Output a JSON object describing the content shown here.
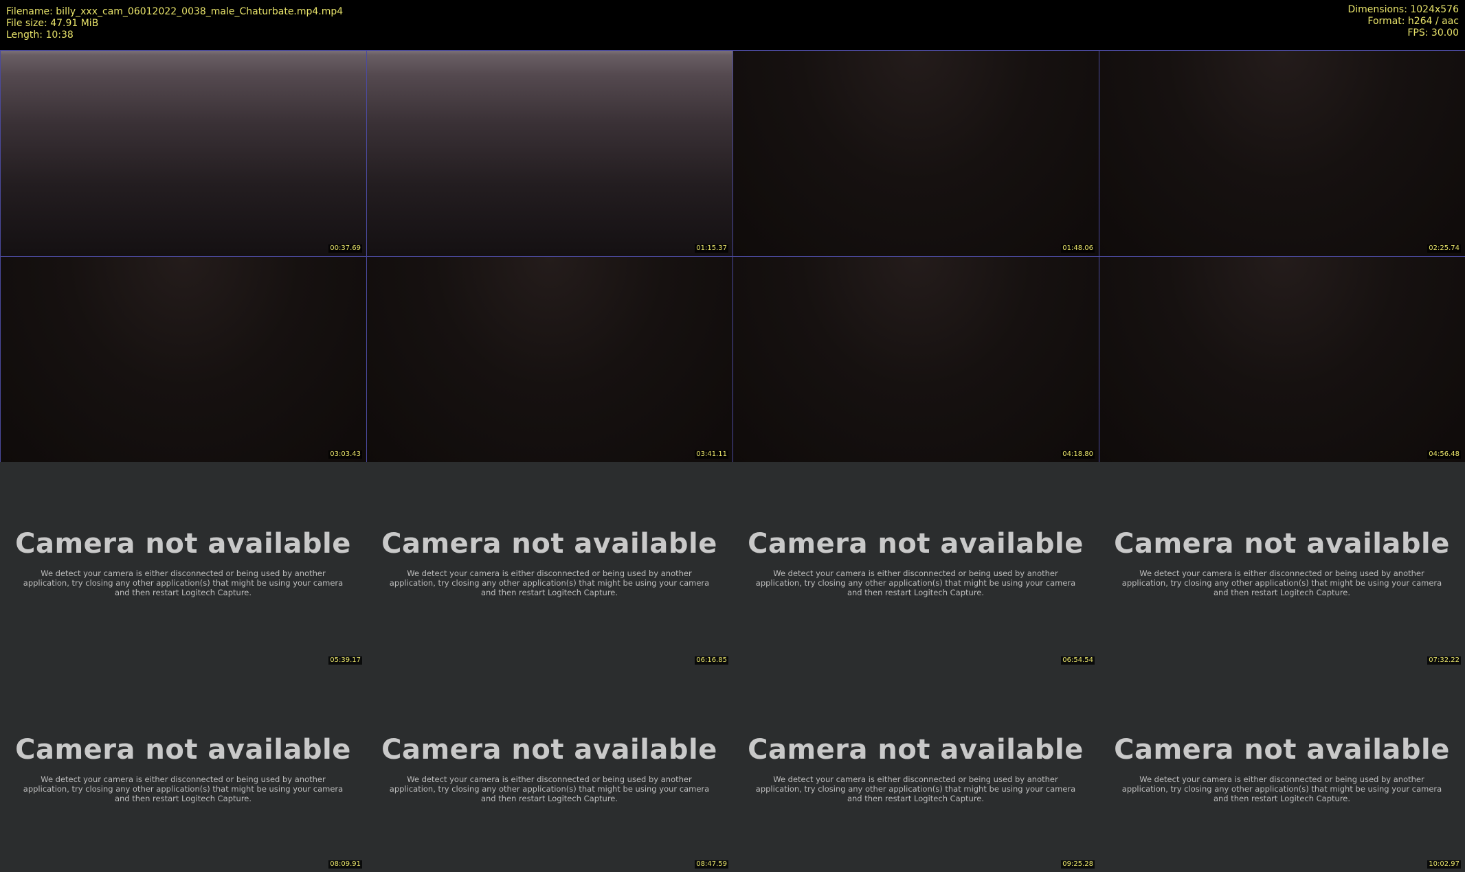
{
  "header": {
    "filename": "Filename: billy_xxx_cam_06012022_0038_male_Chaturbate.mp4.mp4",
    "file_size": "File size: 47.91 MiB",
    "length": "Length: 10:38",
    "dimensions": "Dimensions: 1024x576",
    "format": "Format: h264 / aac",
    "fps": "FPS: 30.00"
  },
  "camera_message": {
    "title": "Camera not available",
    "body": "We detect your camera is either disconnected or being used by another application, try closing any other application(s) that might be using your camera and then restart Logitech Capture."
  },
  "thumbnails": [
    {
      "timestamp": "00:37.69",
      "kind": "video"
    },
    {
      "timestamp": "01:15.37",
      "kind": "video"
    },
    {
      "timestamp": "01:48.06",
      "kind": "video"
    },
    {
      "timestamp": "02:25.74",
      "kind": "video"
    },
    {
      "timestamp": "03:03.43",
      "kind": "video"
    },
    {
      "timestamp": "03:41.11",
      "kind": "video"
    },
    {
      "timestamp": "04:18.80",
      "kind": "video"
    },
    {
      "timestamp": "04:56.48",
      "kind": "video"
    },
    {
      "timestamp": "05:39.17",
      "kind": "camera"
    },
    {
      "timestamp": "06:16.85",
      "kind": "camera"
    },
    {
      "timestamp": "06:54.54",
      "kind": "camera"
    },
    {
      "timestamp": "07:32.22",
      "kind": "camera"
    },
    {
      "timestamp": "08:09.91",
      "kind": "camera"
    },
    {
      "timestamp": "08:47.59",
      "kind": "camera"
    },
    {
      "timestamp": "09:25.28",
      "kind": "camera"
    },
    {
      "timestamp": "10:02.97",
      "kind": "camera"
    }
  ],
  "colors": {
    "header_text": "#e8e36a",
    "tile_border": "#4b4a9e",
    "camera_bg": "#2b2d2e"
  }
}
